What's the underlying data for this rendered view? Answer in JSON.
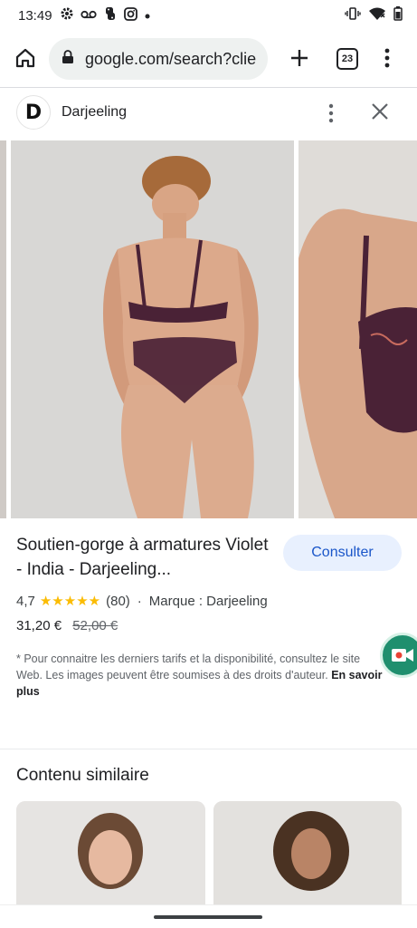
{
  "statusbar": {
    "time": "13:49",
    "icons": [
      "settings-icon",
      "voicemail-icon",
      "python-icon",
      "instagram-icon",
      "dot-icon"
    ],
    "right_icons": [
      "vibrate-icon",
      "wifi-icon",
      "battery-icon"
    ]
  },
  "browser": {
    "url": "google.com/search?clie",
    "tab_count": "23"
  },
  "source": {
    "logo_letter": "D",
    "name": "Darjeeling"
  },
  "product": {
    "title": "Soutien-gorge à armatures Violet - India - Darjeeling...",
    "consult_label": "Consulter",
    "rating_value": "4,7",
    "stars": "★★★★★",
    "review_count": "(80)",
    "separator": "·",
    "brand": "Marque : Darjeeling",
    "price": "31,20 €",
    "old_price": "52,00 €",
    "disclaimer": "* Pour connaitre les derniers tarifs et la disponibilité, consultez le site Web. Les images peuvent être soumises à des droits d'auteur.",
    "learn_more": "En savoir plus"
  },
  "similar": {
    "title": "Contenu similaire"
  },
  "colors": {
    "accent": "#1a56c9",
    "star": "#fbbc04",
    "product_color": "#4a2236"
  }
}
